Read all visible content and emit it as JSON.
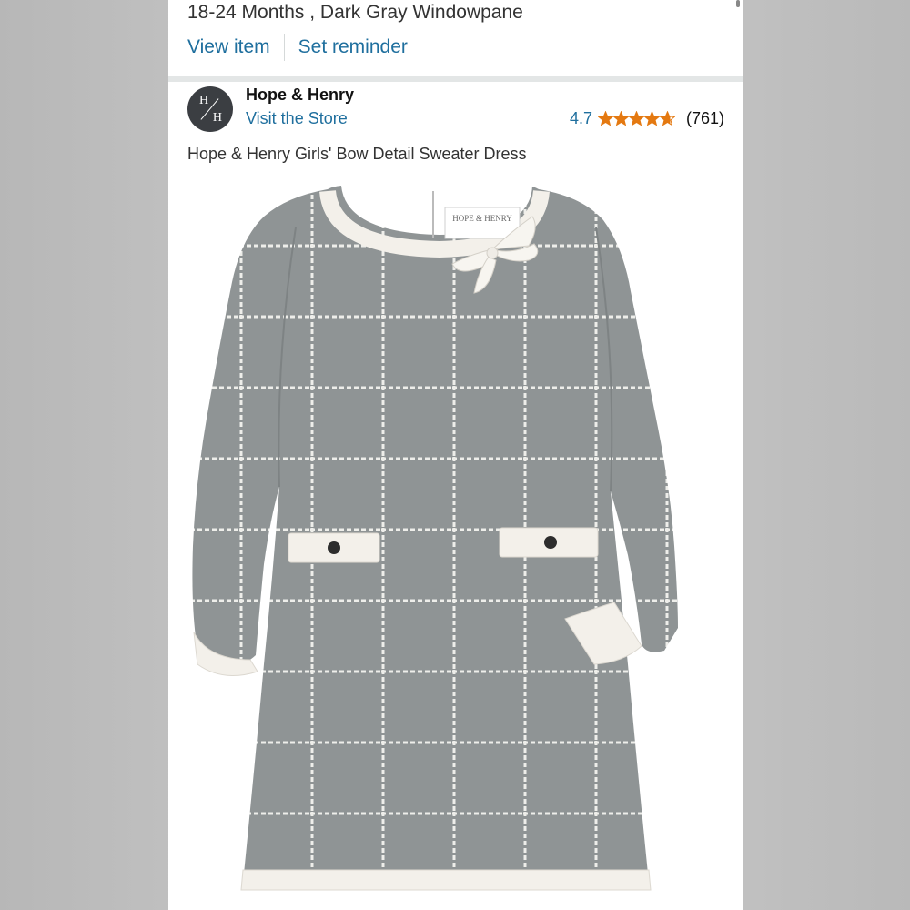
{
  "order_item": {
    "variant": "18-24 Months , Dark Gray Windowpane",
    "view_item_label": "View item",
    "set_reminder_label": "Set reminder"
  },
  "brand": {
    "logo_letters": [
      "H",
      "H"
    ],
    "name": "Hope & Henry",
    "store_link": "Visit the Store"
  },
  "rating": {
    "value": "4.7",
    "stars": 4.7,
    "count": "(761)",
    "star_color": "#e47911"
  },
  "product": {
    "title": "Hope & Henry Girls' Bow Detail Sweater Dress",
    "label_text": "HOPE & HENRY",
    "dress_color": "#8f9495",
    "trim_color": "#f3f0ea"
  },
  "colors": {
    "link": "#1f6f9e"
  }
}
